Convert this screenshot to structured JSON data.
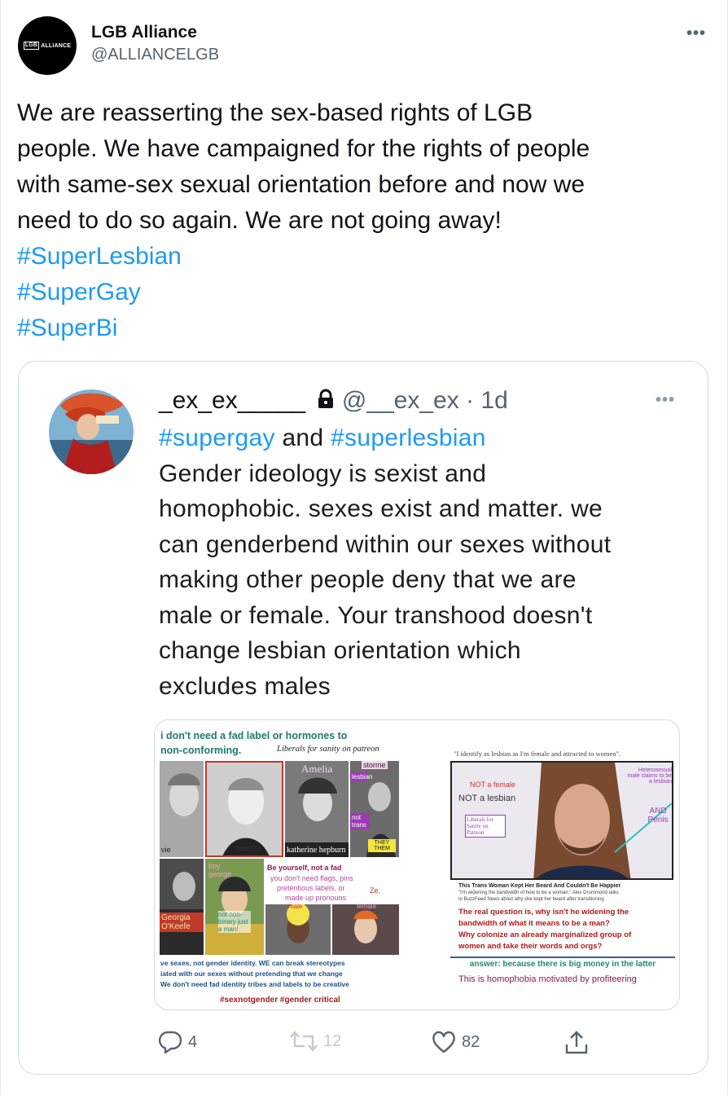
{
  "tweet": {
    "author_name": "LGB Alliance",
    "author_handle": "@ALLIANCELGB",
    "avatar_logo_text": "LGB",
    "avatar_logo_text2": "ALLIANCE",
    "more": "•••",
    "text_lines": [
      "We are reasserting the sex-based rights of LGB",
      "people. We have campaigned for the rights of people",
      "with same-sex sexual orientation before and now we",
      "need to do so again. We are not going away!"
    ],
    "hashtags": [
      "#SuperLesbian",
      "#SuperGay",
      "#SuperBi"
    ]
  },
  "quoted": {
    "author_name": "_ex_ex_____",
    "author_handle": "@__ex_ex",
    "time": "· 1d",
    "more": "•••",
    "hashtag1": "#supergay",
    "and": " and ",
    "hashtag2": "#superlesbian",
    "text_lines": [
      "Gender ideology is sexist and",
      "homophobic. sexes exist and matter. we",
      "can genderbend within our sexes without",
      "making other people deny that we are",
      "male or female. Your transhood doesn't",
      "change lesbian orientation which",
      "excludes males"
    ],
    "image": {
      "left": {
        "top1": "i don't need a fad label or hormones to",
        "top2": "non-conforming.",
        "sign": "Liberals for sanity on patreon",
        "captions": {
          "amelia": "Amelia",
          "storme": "storme",
          "lesbian": "lesbian",
          "not_trans": "not trans",
          "swinton": "swinton",
          "katherine": "katherine hepburn",
          "they_them": "THEY THEM",
          "vie": "vie",
          "boy_george": "boy george",
          "georgia": "Georgia O'Keefe",
          "not_nonbinary": "not non-binary just a man!",
          "male": "male",
          "female": "female",
          "be_yourself": "Be yourself, not a fad",
          "flags": "you don't need flags, pins",
          "labels": "pretentious labels, or",
          "pronouns": "made up pronouns",
          "ze": "Ze,"
        },
        "bottom1": "ve sexes, not gender identity. WE can break stereotypes",
        "bottom2": "iated with our sexes without pretending that we change",
        "bottom3": "We don't need fad identity tribes and labels to be creative",
        "tags": "#sexnotgender   #gender critical"
      },
      "right": {
        "quote": "\"I identify as lesbian as I'm female and attracted to women\".",
        "not_female": "NOT a female",
        "not_lesbian": "NOT a lesbian",
        "liberals": "Liberals for Sanity on Patreon",
        "hetero": "Heterosexual male claims to be a lesbian",
        "and_penis": "AND Penis",
        "headline": "This Trans Woman Kept Her Beard And Couldn't Be Happier",
        "sub1": "\"I'm widening the bandwidth of how to be a woman.\" Alex Drummond talks",
        "sub2": "to BuzzFeed News about why she kept her beard after transitioning",
        "q1": "The real question is, why isn't he widening the",
        "q2": "bandwidth of what it means to be a man?",
        "q3": "Why colonize an already  marginalized group of",
        "q4": "women and take their words and orgs?",
        "answer": "answer: because there is big money in the latter",
        "homophobia": "This is homophobia motivated by profiteering"
      }
    }
  },
  "actions": {
    "replies": "4",
    "retweets": "12",
    "likes": "82"
  }
}
